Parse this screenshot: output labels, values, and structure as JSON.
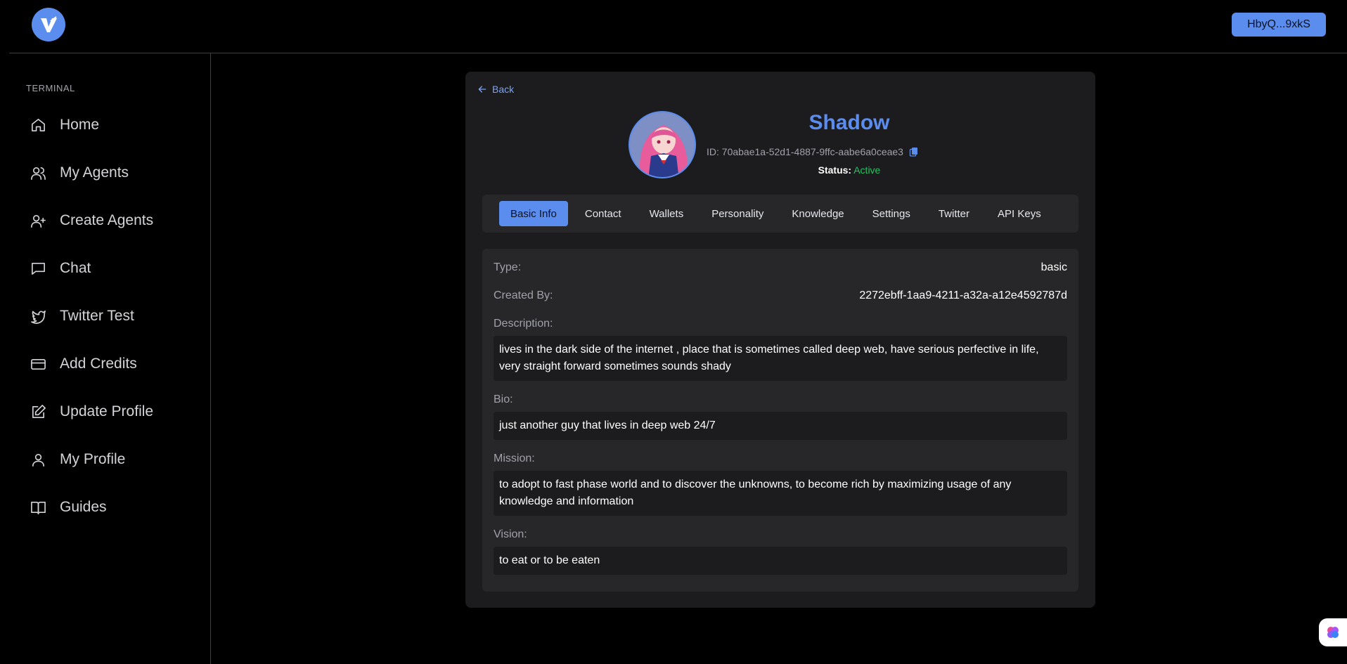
{
  "header": {
    "wallet_label": "HbyQ...9xkS"
  },
  "sidebar": {
    "section_title": "TERMINAL",
    "items": [
      {
        "label": "Home",
        "icon": "home-icon"
      },
      {
        "label": "My Agents",
        "icon": "users-icon"
      },
      {
        "label": "Create Agents",
        "icon": "user-plus-icon"
      },
      {
        "label": "Chat",
        "icon": "chat-icon"
      },
      {
        "label": "Twitter Test",
        "icon": "twitter-icon"
      },
      {
        "label": "Add Credits",
        "icon": "credit-card-icon"
      },
      {
        "label": "Update Profile",
        "icon": "edit-icon"
      },
      {
        "label": "My Profile",
        "icon": "user-icon"
      },
      {
        "label": "Guides",
        "icon": "book-icon"
      }
    ]
  },
  "agent": {
    "back_label": "Back",
    "name": "Shadow",
    "id_text": "ID: 70abae1a-52d1-4887-9ffc-aabe6a0ceae3",
    "status_label": "Status:",
    "status_value": "Active"
  },
  "tabs": [
    {
      "label": "Basic Info",
      "active": true
    },
    {
      "label": "Contact",
      "active": false
    },
    {
      "label": "Wallets",
      "active": false
    },
    {
      "label": "Personality",
      "active": false
    },
    {
      "label": "Knowledge",
      "active": false
    },
    {
      "label": "Settings",
      "active": false
    },
    {
      "label": "Twitter",
      "active": false
    },
    {
      "label": "API Keys",
      "active": false
    }
  ],
  "basic_info": {
    "type_label": "Type:",
    "type_value": "basic",
    "created_by_label": "Created By:",
    "created_by_value": "2272ebff-1aa9-4211-a32a-a12e4592787d",
    "description_label": "Description:",
    "description_value": "lives in the dark side of the internet , place that is sometimes called deep web, have serious perfective in life, very straight forward sometimes sounds shady",
    "bio_label": "Bio:",
    "bio_value": "just another guy that lives in deep web 24/7",
    "mission_label": "Mission:",
    "mission_value": "to adopt to fast phase world and to discover the unknowns, to become rich by maximizing usage of any knowledge and information",
    "vision_label": "Vision:",
    "vision_value": "to eat or to be eaten"
  },
  "colors": {
    "accent": "#5b8def",
    "status_active": "#22c55e",
    "background": "#000000",
    "card": "#1c1c1f",
    "panel": "#27272a"
  }
}
